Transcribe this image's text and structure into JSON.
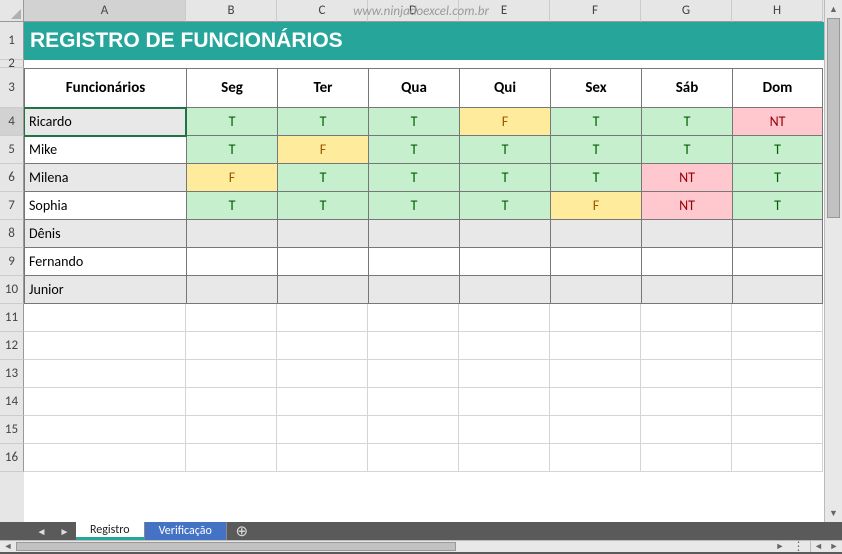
{
  "watermark": "www.ninjadoexcel.com.br",
  "columns": [
    "A",
    "B",
    "C",
    "D",
    "E",
    "F",
    "G",
    "H"
  ],
  "rowNumbers": [
    1,
    2,
    3,
    4,
    5,
    6,
    7,
    8,
    9,
    10,
    11,
    12,
    13,
    14,
    15,
    16
  ],
  "title": "REGISTRO DE FUNCIONÁRIOS",
  "headers": [
    "Funcionários",
    "Seg",
    "Ter",
    "Qua",
    "Qui",
    "Sex",
    "Sáb",
    "Dom"
  ],
  "rows": [
    {
      "name": "Ricardo",
      "alt": true,
      "values": [
        "T",
        "T",
        "T",
        "F",
        "T",
        "T",
        "NT"
      ]
    },
    {
      "name": "Mike",
      "alt": false,
      "values": [
        "T",
        "F",
        "T",
        "T",
        "T",
        "T",
        "T"
      ]
    },
    {
      "name": "Milena",
      "alt": true,
      "values": [
        "F",
        "T",
        "T",
        "T",
        "T",
        "NT",
        "T"
      ]
    },
    {
      "name": "Sophia",
      "alt": false,
      "values": [
        "T",
        "T",
        "T",
        "T",
        "F",
        "NT",
        "T"
      ]
    },
    {
      "name": "Dênis",
      "alt": true,
      "values": [
        "",
        "",
        "",
        "",
        "",
        "",
        ""
      ]
    },
    {
      "name": "Fernando",
      "alt": false,
      "values": [
        "",
        "",
        "",
        "",
        "",
        "",
        ""
      ]
    },
    {
      "name": "Junior",
      "alt": true,
      "values": [
        "",
        "",
        "",
        "",
        "",
        "",
        ""
      ]
    }
  ],
  "activeCell": {
    "row": 0,
    "col": 0
  },
  "sheetTabs": [
    {
      "label": "Registro",
      "active": true
    },
    {
      "label": "Verificação",
      "active": false
    }
  ],
  "rowHeights": {
    "title": 38,
    "spacer": 8,
    "header": 40,
    "data": 28,
    "empty": 28
  }
}
